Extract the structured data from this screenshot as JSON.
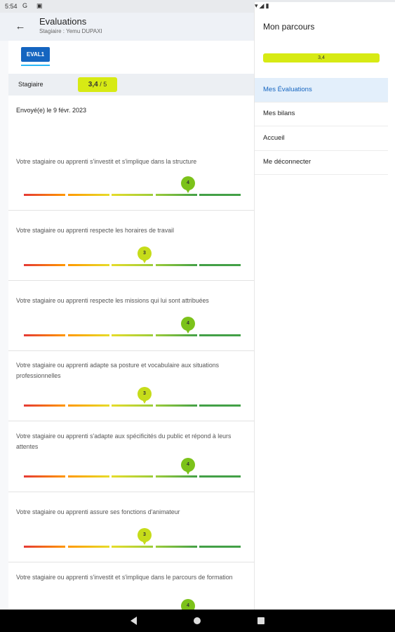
{
  "status_bar": {
    "time": "5:54",
    "icons": [
      "g-icon",
      "doc-icon",
      "wifi-icon",
      "signal-icon",
      "battery-icon"
    ]
  },
  "header": {
    "title": "Evaluations",
    "subtitle": "Stagiaire : Yemu DUPAXI"
  },
  "tab": {
    "label": "EVAL1"
  },
  "score": {
    "label": "Stagiaire",
    "value": "3,4",
    "max": " / 5"
  },
  "sent_date": "Envoyé(e) le 9 févr. 2023",
  "scale": {
    "min": 1,
    "max": 5,
    "colors": [
      "#e53935",
      "#ff9800",
      "#e6dc2a",
      "#9ccc3a",
      "#43a047"
    ]
  },
  "questions": [
    {
      "text": "Votre stagiaire ou apprenti s'investit et s'implique dans la structure",
      "rating": 4,
      "rating_label": "4"
    },
    {
      "text": "Votre stagiaire ou apprenti respecte les horaires de travail",
      "rating": 3,
      "rating_label": "3"
    },
    {
      "text": "Votre stagiaire ou apprenti respecte les missions qui lui sont attribuées",
      "rating": 4,
      "rating_label": "4"
    },
    {
      "text": "Votre stagiaire ou apprenti adapte sa posture et vocabulaire aux situations professionnelles",
      "rating": 3,
      "rating_label": "3"
    },
    {
      "text": "Votre stagiaire ou apprenti s'adapte aux spécificités du public et répond à leurs attentes",
      "rating": 4,
      "rating_label": "4"
    },
    {
      "text": "Votre stagiaire ou apprenti assure ses fonctions d'animateur",
      "rating": 3,
      "rating_label": "3"
    },
    {
      "text": "Votre stagiaire ou apprenti s'investit et s'implique dans le parcours de formation",
      "rating": 4,
      "rating_label": "4"
    }
  ],
  "pin_colors": {
    "3": "#c6dc1a",
    "4": "#7cc21a"
  },
  "sidebar": {
    "title": "Mon parcours",
    "progress_label": "3,4",
    "items": [
      {
        "label": "Mes Évaluations",
        "active": true
      },
      {
        "label": "Mes bilans",
        "active": false
      },
      {
        "label": "Accueil",
        "active": false
      },
      {
        "label": "Me déconnecter",
        "active": false
      }
    ]
  }
}
